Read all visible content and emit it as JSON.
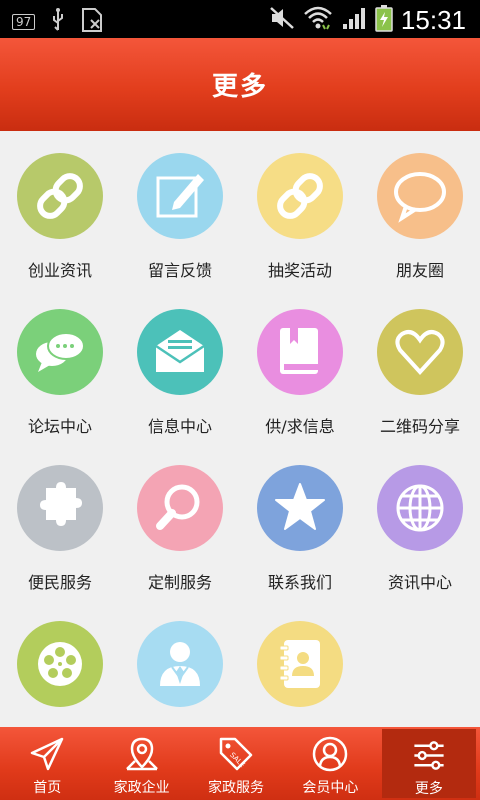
{
  "status_bar": {
    "badge": "97",
    "time": "15:31"
  },
  "header": {
    "title": "更多"
  },
  "grid": {
    "items": [
      {
        "label": "创业资讯",
        "icon": "link-icon",
        "color": "#b7c96a"
      },
      {
        "label": "留言反馈",
        "icon": "edit-icon",
        "color": "#9ad7ee"
      },
      {
        "label": "抽奖活动",
        "icon": "link-icon",
        "color": "#f6dd86"
      },
      {
        "label": "朋友圈",
        "icon": "chat-bubble-icon",
        "color": "#f7bf8a"
      },
      {
        "label": "论坛中心",
        "icon": "chat-icon",
        "color": "#7bd07a"
      },
      {
        "label": "信息中心",
        "icon": "envelope-icon",
        "color": "#4cc1b9"
      },
      {
        "label": "供/求信息",
        "icon": "book-icon",
        "color": "#e98ee0"
      },
      {
        "label": "二维码分享",
        "icon": "heart-icon",
        "color": "#cfc55d"
      },
      {
        "label": "便民服务",
        "icon": "puzzle-icon",
        "color": "#bcc1c7"
      },
      {
        "label": "定制服务",
        "icon": "magnifier-icon",
        "color": "#f4a4b4"
      },
      {
        "label": "联系我们",
        "icon": "star-icon",
        "color": "#7ea3dc"
      },
      {
        "label": "资讯中心",
        "icon": "globe-icon",
        "color": "#b79ae6"
      },
      {
        "label": "",
        "icon": "film-reel-icon",
        "color": "#b3cd5c"
      },
      {
        "label": "",
        "icon": "person-icon",
        "color": "#a7dcf2"
      },
      {
        "label": "",
        "icon": "contacts-icon",
        "color": "#f4dc82"
      }
    ]
  },
  "tabbar": {
    "tabs": [
      {
        "label": "首页",
        "icon": "paper-plane-icon"
      },
      {
        "label": "家政企业",
        "icon": "map-pin-icon"
      },
      {
        "label": "家政服务",
        "icon": "sale-tag-icon"
      },
      {
        "label": "会员中心",
        "icon": "user-circle-icon"
      },
      {
        "label": "更多",
        "icon": "sliders-icon"
      }
    ],
    "active_index": 4
  }
}
